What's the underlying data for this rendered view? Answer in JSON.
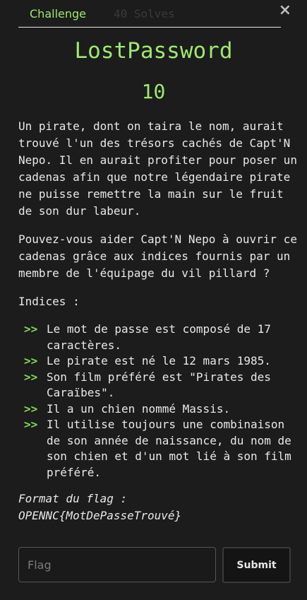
{
  "header": {
    "tab_challenge": "Challenge",
    "tab_solves": "40 Solves",
    "close_symbol": "×"
  },
  "challenge": {
    "title": "LostPassword",
    "points": "10",
    "paragraph1": "Un pirate, dont on taira le nom, aurait trouvé l'un des trésors cachés de Capt'N Nepo. Il en aurait profiter pour poser un cadenas afin que notre légendaire pirate ne puisse remettre la main sur le fruit de son dur labeur.",
    "paragraph2": "Pouvez-vous aider Capt'N Nepo à ouvrir ce cadenas grâce aux indices fournis par un membre de l'équipage du vil pillard ?",
    "hints_title": "Indices :",
    "hint_marker": ">>",
    "hints": [
      "Le mot de passe est composé de 17 caractères.",
      "Le pirate est né le 12 mars 1985.",
      "Son film préféré est \"Pirates des Caraïbes\".",
      "Il a un chien nommé Massis.",
      "Il utilise toujours une combinaison de son année de naissance, du nom de son chien et d'un mot lié à son film préféré."
    ],
    "format_label": "Format du flag :",
    "format_value": "OPENNC{MotDePasseTrouvé}"
  },
  "form": {
    "flag_placeholder": "Flag",
    "flag_value": "",
    "submit_label": "Submit"
  },
  "colors": {
    "accent": "#9fe870",
    "background": "#1c1c1c"
  },
  "icons": {
    "close": "close-icon"
  }
}
